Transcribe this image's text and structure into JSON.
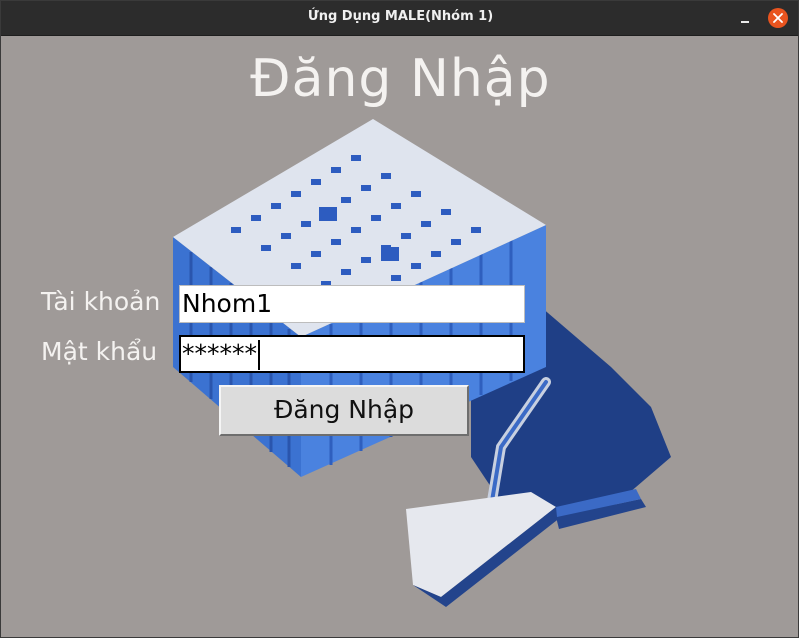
{
  "window": {
    "title": "Ứng Dụng MALE(Nhóm 1)",
    "close_color": "#e9541f",
    "background_color": "#9f9a98"
  },
  "icons": {
    "minimize": "minimize-icon",
    "close": "close-icon",
    "background": "brick-and-trowel-illustration"
  },
  "form": {
    "heading": "Đăng Nhập",
    "username_label": "Tài khoản",
    "username_value": "Nhom1",
    "password_label": "Mật khẩu",
    "password_value": "******",
    "submit_label": "Đăng Nhập"
  }
}
